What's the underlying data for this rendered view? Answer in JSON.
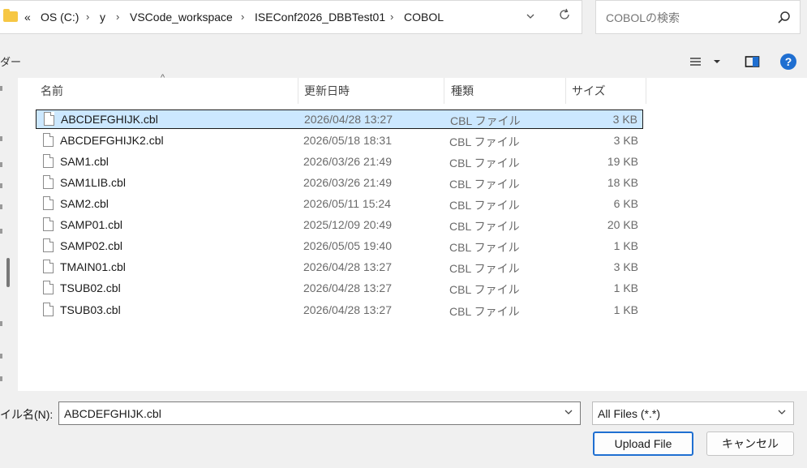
{
  "address": {
    "breadcrumb": [
      "«",
      "OS (C:)",
      "y",
      "VSCode_workspace",
      "ISEConf2026_DBBTest01",
      "COBOL"
    ],
    "separator": "›",
    "dropdown_icon": "chevron-down-icon",
    "refresh_icon": "refresh-icon"
  },
  "search": {
    "placeholder": "COBOLの検索",
    "icon": "search-icon"
  },
  "toolbar": {
    "left_label": "ダー",
    "view_icon": "view-list-icon",
    "preview_icon": "preview-pane-icon",
    "help_label": "?"
  },
  "columns": {
    "name": "名前",
    "date": "更新日時",
    "type": "種類",
    "size": "サイズ"
  },
  "files": [
    {
      "name": "ABCDEFGHIJK.cbl",
      "date": "2026/04/28 13:27",
      "type": "CBL ファイル",
      "size": "3 KB",
      "selected": true
    },
    {
      "name": "ABCDEFGHIJK2.cbl",
      "date": "2026/05/18 18:31",
      "type": "CBL ファイル",
      "size": "3 KB"
    },
    {
      "name": "SAM1.cbl",
      "date": "2026/03/26 21:49",
      "type": "CBL ファイル",
      "size": "19 KB"
    },
    {
      "name": "SAM1LIB.cbl",
      "date": "2026/03/26 21:49",
      "type": "CBL ファイル",
      "size": "18 KB"
    },
    {
      "name": "SAM2.cbl",
      "date": "2026/05/11 15:24",
      "type": "CBL ファイル",
      "size": "6 KB"
    },
    {
      "name": "SAMP01.cbl",
      "date": "2025/12/09 20:49",
      "type": "CBL ファイル",
      "size": "20 KB"
    },
    {
      "name": "SAMP02.cbl",
      "date": "2026/05/05 19:40",
      "type": "CBL ファイル",
      "size": "1 KB"
    },
    {
      "name": "TMAIN01.cbl",
      "date": "2026/04/28 13:27",
      "type": "CBL ファイル",
      "size": "3 KB"
    },
    {
      "name": "TSUB02.cbl",
      "date": "2026/04/28 13:27",
      "type": "CBL ファイル",
      "size": "1 KB"
    },
    {
      "name": "TSUB03.cbl",
      "date": "2026/04/28 13:27",
      "type": "CBL ファイル",
      "size": "1 KB"
    }
  ],
  "bottom": {
    "filename_label": "イル名(N):",
    "filename_value": "ABCDEFGHIJK.cbl",
    "filetype_value": "All Files (*.*)",
    "upload_label": "Upload File",
    "cancel_label": "キャンセル"
  },
  "colors": {
    "selection": "#cce8ff",
    "accent": "#1f6fd1",
    "folder": "#f6c744"
  }
}
